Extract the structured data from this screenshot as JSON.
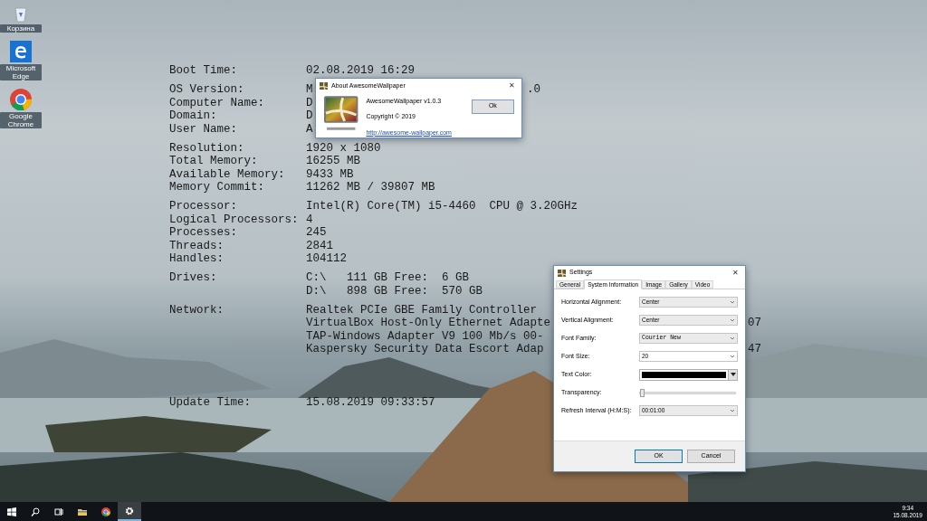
{
  "desktop_icons": [
    {
      "kind": "recycle",
      "label": "Корзина"
    },
    {
      "kind": "edge",
      "label": "Microsoft Edge"
    },
    {
      "kind": "chrome",
      "label": "Google Chrome"
    }
  ],
  "system_info": [
    {
      "rows": [
        {
          "label": "Boot Time:",
          "lines": [
            {
              "text": "02.08.2019 16:29"
            }
          ]
        }
      ]
    },
    {
      "rows": [
        {
          "label": "OS Version:",
          "lines": [
            {
              "text": "M",
              "tail": ".0",
              "kind": "behind_about"
            }
          ]
        },
        {
          "label": "Computer Name:",
          "lines": [
            {
              "text": "D"
            }
          ]
        },
        {
          "label": "Domain:",
          "lines": [
            {
              "text": "D"
            }
          ]
        },
        {
          "label": "User Name:",
          "lines": [
            {
              "text": "A"
            }
          ]
        }
      ]
    },
    {
      "rows": [
        {
          "label": "Resolution:",
          "lines": [
            {
              "text": "1920 x 1080"
            }
          ]
        },
        {
          "label": "Total Memory:",
          "lines": [
            {
              "text": "16255 MB"
            }
          ]
        },
        {
          "label": "Available Memory:",
          "lines": [
            {
              "text": "9433 MB"
            }
          ]
        },
        {
          "label": "Memory Commit:",
          "lines": [
            {
              "text": "11262 MB / 39807 MB"
            }
          ]
        }
      ]
    },
    {
      "rows": [
        {
          "label": "Processor:",
          "lines": [
            {
              "text": "Intel(R) Core(TM) i5-4460  CPU @ 3.20GHz"
            }
          ]
        },
        {
          "label": "Logical Processors:",
          "lines": [
            {
              "text": "4"
            }
          ]
        },
        {
          "label": "Processes:",
          "lines": [
            {
              "text": "245"
            }
          ]
        },
        {
          "label": "Threads:",
          "lines": [
            {
              "text": "2841"
            }
          ]
        },
        {
          "label": "Handles:",
          "lines": [
            {
              "text": "104112"
            }
          ]
        }
      ]
    },
    {
      "rows": [
        {
          "label": "Drives:",
          "lines": [
            {
              "text": "C:\\   111 GB Free:  6 GB"
            },
            {
              "text": "D:\\   898 GB Free:  570 GB"
            }
          ]
        }
      ]
    },
    {
      "rows": [
        {
          "label": "Network:",
          "lines": [
            {
              "text": "Realtek PCIe GBE Family Controller"
            },
            {
              "text": "VirtualBox Host-Only Ethernet Adapte",
              "tail": "07",
              "kind": "behind_settings"
            },
            {
              "text": "TAP-Windows Adapter V9 100 Mb/s 00-"
            },
            {
              "text": "Kaspersky Security Data Escort Adap",
              "tail": "47",
              "kind": "behind_settings"
            }
          ]
        }
      ]
    },
    {
      "spaced": true,
      "rows": [
        {
          "label": "Update Time:",
          "lines": [
            {
              "text": "15.08.2019 09:33:57"
            }
          ]
        }
      ]
    }
  ],
  "about_window": {
    "title": "About AwesomeWallpaper",
    "close": "✕",
    "product": "AwesomeWallpaper v1.0.3",
    "copyright": "Copyright © 2019",
    "link": "http://awesome-wallpaper.com",
    "button": "Ok"
  },
  "settings_window": {
    "title": "Settings",
    "close": "✕",
    "tabs": [
      {
        "label": "General",
        "selected": false
      },
      {
        "label": "System Information",
        "selected": true
      },
      {
        "label": "Image",
        "selected": false
      },
      {
        "label": "Gallery",
        "selected": false
      },
      {
        "label": "Video",
        "selected": false
      }
    ],
    "fields": [
      {
        "kind": "dropdown",
        "label": "Horizontal Alignment:",
        "value": "Center",
        "disabled": true
      },
      {
        "kind": "dropdown",
        "label": "Vertical Alignment:",
        "value": "Center",
        "disabled": true
      },
      {
        "kind": "font",
        "label": "Font Family:",
        "value": "Courier New",
        "disabled": true
      },
      {
        "kind": "dropdown",
        "label": "Font Size:",
        "value": "20",
        "disabled": false
      },
      {
        "kind": "color",
        "label": "Text Color:",
        "color": "#000000"
      },
      {
        "kind": "slider",
        "label": "Transparency:",
        "level": 0.0
      },
      {
        "kind": "dropdown",
        "label": "Refresh Interval (H:M:S):",
        "value": "00:01:00",
        "disabled": true
      }
    ],
    "buttons": [
      {
        "label": "OK",
        "default": true
      },
      {
        "label": "Cancel",
        "default": false
      }
    ]
  },
  "taskbar": {
    "items": [
      {
        "kind": "start",
        "active": false
      },
      {
        "kind": "search",
        "active": false
      },
      {
        "kind": "taskview",
        "active": false
      },
      {
        "kind": "folder",
        "active": false
      },
      {
        "kind": "chrome",
        "active": false
      },
      {
        "kind": "gear",
        "active": true
      }
    ],
    "time": "9:34",
    "date": "15.08.2019"
  }
}
